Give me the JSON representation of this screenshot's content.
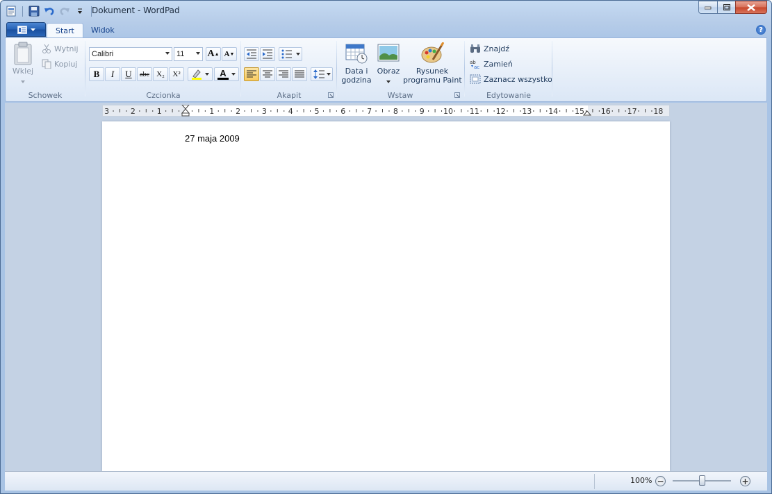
{
  "title_bar": {
    "title": "Dokument - WordPad",
    "qat_icons": [
      "wordpad-app-icon",
      "save-icon",
      "undo-icon",
      "redo-icon",
      "customize-qat-icon"
    ]
  },
  "tabs": [
    {
      "label": "Start",
      "active": true
    },
    {
      "label": "Widok",
      "active": false
    }
  ],
  "ribbon": {
    "clipboard": {
      "label": "Schowek",
      "paste_label": "Wklej",
      "cut_label": "Wytnij",
      "copy_label": "Kopiuj"
    },
    "font": {
      "label": "Czcionka",
      "font_name": "Calibri",
      "font_size": "11",
      "grow_font": "A",
      "shrink_font": "A",
      "bold": "B",
      "italic": "I",
      "underline": "U",
      "strikethrough": "abc",
      "subscript": "X₂",
      "superscript": "X²",
      "font_color_glyph": "A"
    },
    "paragraph": {
      "label": "Akapit"
    },
    "insert": {
      "label": "Wstaw",
      "datetime_line1": "Data i",
      "datetime_line2": "godzina",
      "picture_label": "Obraz",
      "paint_line1": "Rysunek",
      "paint_line2": "programu Paint"
    },
    "editing": {
      "label": "Edytowanie",
      "find_label": "Znajdź",
      "replace_label": "Zamień",
      "select_all_label": "Zaznacz wszystko"
    }
  },
  "ruler": {
    "labels": [
      "3",
      "2",
      "1",
      "1",
      "2",
      "3",
      "4",
      "5",
      "6",
      "7",
      "8",
      "9",
      "10",
      "11",
      "12",
      "13",
      "14",
      "15",
      "16",
      "17",
      "18"
    ]
  },
  "document": {
    "text": "27 maja 2009"
  },
  "status_bar": {
    "zoom": "100%",
    "zoom_out": "−",
    "zoom_in": "+"
  },
  "colors": {
    "accent": "#2561b5",
    "selected_button": "#f9cb60",
    "font_color_bar": "#000000",
    "highlight_bar": "#ffff00"
  }
}
